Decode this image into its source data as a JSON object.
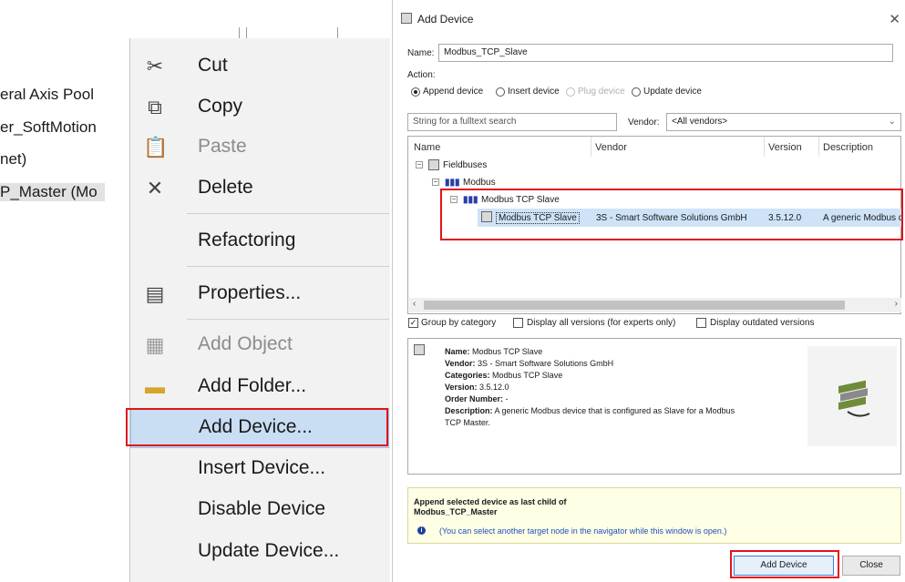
{
  "tree": {
    "items": [
      {
        "label": "eral Axis Pool",
        "selected": false
      },
      {
        "label": "er_SoftMotion",
        "selected": false
      },
      {
        "label": "net)",
        "selected": false
      },
      {
        "label": "P_Master (Mo",
        "selected": true
      }
    ]
  },
  "context_menu": {
    "items": [
      {
        "label": "Cut",
        "icon": "scissors-icon",
        "enabled": true
      },
      {
        "label": "Copy",
        "icon": "copy-icon",
        "enabled": true
      },
      {
        "label": "Paste",
        "icon": "paste-icon",
        "enabled": false
      },
      {
        "label": "Delete",
        "icon": "delete-x-icon",
        "enabled": true
      },
      {
        "label": "Refactoring",
        "icon": "",
        "enabled": true
      },
      {
        "label": "Properties...",
        "icon": "properties-icon",
        "enabled": true
      },
      {
        "label": "Add Object",
        "icon": "add-object-icon",
        "enabled": false
      },
      {
        "label": "Add Folder...",
        "icon": "folder-icon",
        "enabled": true
      },
      {
        "label": "Add Device...",
        "icon": "",
        "enabled": true,
        "highlighted": true
      },
      {
        "label": "Insert Device...",
        "icon": "",
        "enabled": true
      },
      {
        "label": "Disable Device",
        "icon": "",
        "enabled": true
      },
      {
        "label": "Update Device...",
        "icon": "",
        "enabled": true
      }
    ]
  },
  "dialog": {
    "title": "Add Device",
    "name_label": "Name:",
    "name_value": "Modbus_TCP_Slave",
    "action_label": "Action:",
    "actions": [
      {
        "label": "Append device",
        "checked": true,
        "enabled": true
      },
      {
        "label": "Insert device",
        "checked": false,
        "enabled": true
      },
      {
        "label": "Plug device",
        "checked": false,
        "enabled": false
      },
      {
        "label": "Update device",
        "checked": false,
        "enabled": true
      }
    ],
    "search_placeholder": "String for a fulltext search",
    "vendor_label": "Vendor:",
    "vendor_value": "<All vendors>",
    "columns": [
      "Name",
      "Vendor",
      "Version",
      "Description"
    ],
    "tree": {
      "fieldbuses": "Fieldbuses",
      "modbus": "Modbus",
      "modbus_tcp_slave_group": "Modbus TCP Slave",
      "device": {
        "name": "Modbus TCP Slave",
        "vendor": "3S - Smart Software Solutions GmbH",
        "version": "3.5.12.0",
        "description": "A generic Modbus d"
      }
    },
    "options": {
      "group_by_category": {
        "label": "Group by category",
        "checked": true
      },
      "display_all_versions": {
        "label": "Display all versions (for experts only)",
        "checked": false
      },
      "display_outdated": {
        "label": "Display outdated versions",
        "checked": false
      }
    },
    "info": {
      "name_key": "Name:",
      "name_val": "Modbus TCP Slave",
      "vendor_key": "Vendor:",
      "vendor_val": "3S - Smart Software Solutions GmbH",
      "categories_key": "Categories:",
      "categories_val": "Modbus TCP Slave",
      "version_key": "Version:",
      "version_val": "3.5.12.0",
      "order_key": "Order Number:",
      "order_val": "-",
      "desc_key": "Description:",
      "desc_val_1": "A generic Modbus device that is configured as Slave for a Modbus",
      "desc_val_2": "TCP Master."
    },
    "note": {
      "line1": "Append selected device as last child of",
      "line2": "Modbus_TCP_Master",
      "hint": "(You can select another target node in the navigator while this window is open.)"
    },
    "buttons": {
      "add": "Add Device",
      "close": "Close"
    }
  },
  "colors": {
    "highlight_box": "#e0151b",
    "menu_hover": "#c9ddf3",
    "selection": "#cfe3f8"
  }
}
